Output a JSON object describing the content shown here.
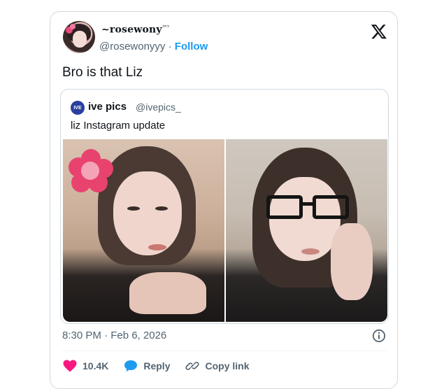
{
  "tweet": {
    "display_name": "~rosewony",
    "display_name_suffix": "ʲʷʸ",
    "handle": "@rosewonyyy",
    "separator": "·",
    "follow_label": "Follow",
    "text": "Bro is that Liz",
    "timestamp": "8:30 PM · Feb 6, 2026"
  },
  "quote": {
    "avatar_text": "IVE",
    "name": "ive pics",
    "handle": "@ivepics_",
    "text": "liz Instagram update"
  },
  "actions": {
    "like_count": "10.4K",
    "reply_label": "Reply",
    "copy_link_label": "Copy link"
  },
  "colors": {
    "accent": "#1d9bf0",
    "like": "#f91880",
    "secondary_text": "#536471"
  },
  "icons": [
    "x-logo-icon",
    "info-icon",
    "heart-icon",
    "reply-bubble-icon",
    "link-icon"
  ]
}
